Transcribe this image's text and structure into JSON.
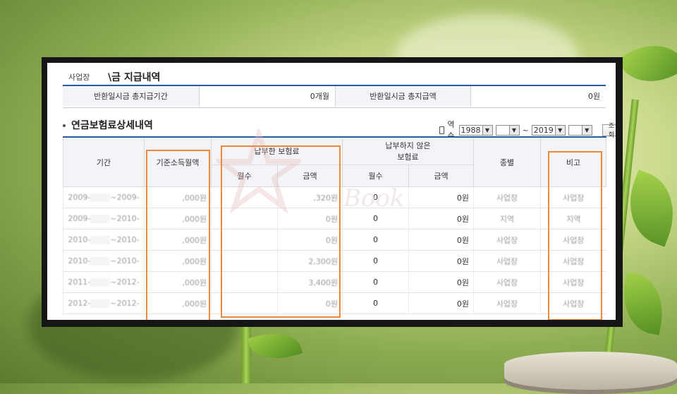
{
  "header": {
    "prefix": "사업장",
    "title": "\\금 지급내역"
  },
  "summary": {
    "label1": "반환일시금 총지급기간",
    "value1": "0개월",
    "label2": "반환일시금 총지급액",
    "value2": "0원"
  },
  "section": {
    "title": "연금보험료상세내역"
  },
  "controls": {
    "reverse_label": "역순",
    "year_from": "1988",
    "tilde": "~",
    "year_to": "2019",
    "search_button": "조회"
  },
  "table": {
    "headers": {
      "period": "기간",
      "base_income": "기준소득월액",
      "paid": "납부한 보험료",
      "unpaid": "납부하지 않은\n보험료",
      "type": "종별",
      "note": "비고",
      "months": "월수",
      "amount": "금액"
    },
    "rows": [
      {
        "from": "2009-",
        "to": "~2009-",
        "income": ",000원",
        "paid_amount": ",320원",
        "unpaid_months": "0",
        "unpaid_amount": "0원",
        "type": "사업장",
        "note": "사업장"
      },
      {
        "from": "2009-",
        "to": "~2010-",
        "income": ",000원",
        "paid_amount": "0원",
        "unpaid_months": "0",
        "unpaid_amount": "0원",
        "type": "지역",
        "note": "지역"
      },
      {
        "from": "2010-",
        "to": "~2010-",
        "income": ",000원",
        "paid_amount": "0원",
        "unpaid_months": "0",
        "unpaid_amount": "0원",
        "type": "사업장",
        "note": "사업장"
      },
      {
        "from": "2010-",
        "to": "~2010-",
        "income": ",000원",
        "paid_amount": "2,300원",
        "unpaid_months": "0",
        "unpaid_amount": "0원",
        "type": "사업장",
        "note": "사업장"
      },
      {
        "from": "2011-",
        "to": "~2012-",
        "income": ",000원",
        "paid_amount": "3,400원",
        "unpaid_months": "0",
        "unpaid_amount": "0원",
        "type": "사업장",
        "note": "사업장"
      },
      {
        "from": "2012-",
        "to": "~2012-",
        "income": ",000원",
        "paid_amount": "0원",
        "unpaid_months": "0",
        "unpaid_amount": "0원",
        "type": "사업장",
        "note": "사업장"
      }
    ]
  },
  "watermark": "Book",
  "colors": {
    "accent": "#2c5aa0",
    "highlight": "#f0883a"
  }
}
